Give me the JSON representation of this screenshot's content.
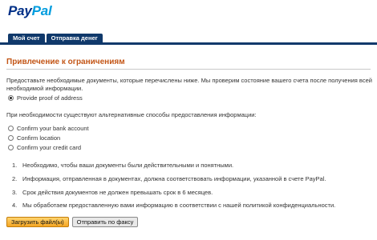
{
  "logo": {
    "pay": "Pay",
    "pal": "Pal"
  },
  "tabs": [
    {
      "label": "Мой счет"
    },
    {
      "label": "Отправка денег"
    }
  ],
  "page": {
    "title": "Привлечение к ограничениям",
    "intro_line1": "Предоставьте необходимые документы, которые перечислены ниже. Мы проверим состояние вашего счета после получения всей",
    "intro_line2": "необходимой информации.",
    "primary_option": "Provide proof of address",
    "alt_intro": "При необходимости существуют альтернативные способы предоставления информации:",
    "alt_options": [
      "Confirm your bank account",
      "Confirm location",
      "Confirm your credit card"
    ],
    "notes": [
      {
        "num": "1.",
        "text": "Необходимо, чтобы ваши документы были действительными и понятными."
      },
      {
        "num": "2.",
        "text": "Информация, отправленная в документах, должна соответствовать информации, указанной в счете PayPal."
      },
      {
        "num": "3.",
        "text": "Срок действия документов не должен превышать срок в 6 месяцев."
      },
      {
        "num": "4.",
        "text": "Мы обработаем предоставленную вами информацию в соответствии с нашей политикой конфиденциальности."
      }
    ]
  },
  "buttons": {
    "upload": "Загрузить файл(ы)",
    "fax": "Отправить по факсу"
  }
}
